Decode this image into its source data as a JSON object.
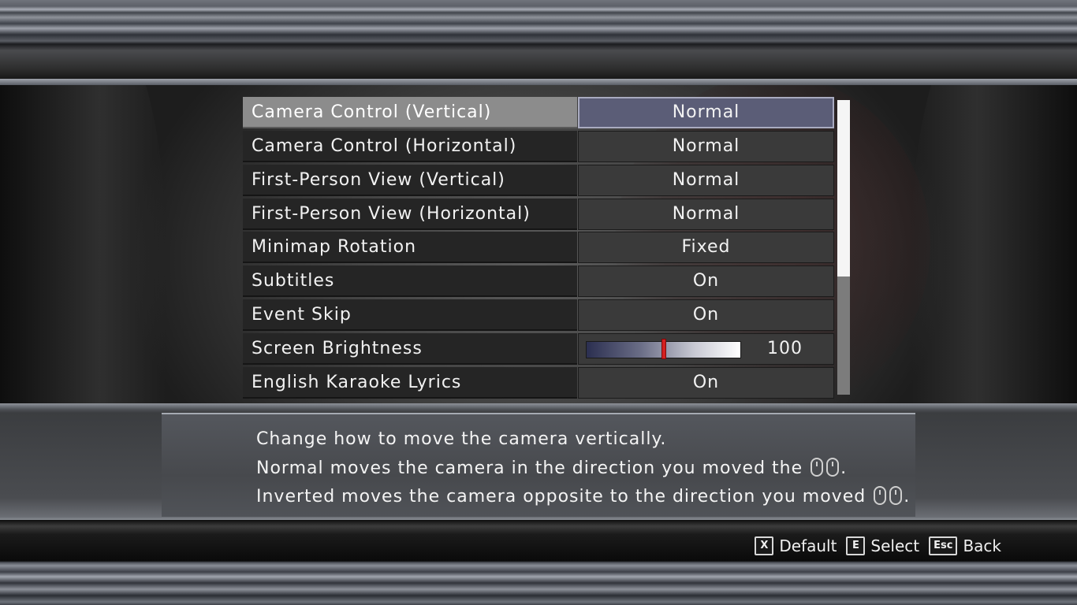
{
  "settings": [
    {
      "label": "Camera Control (Vertical)",
      "value": "Normal",
      "selected": true
    },
    {
      "label": "Camera Control (Horizontal)",
      "value": "Normal"
    },
    {
      "label": "First-Person View (Vertical)",
      "value": "Normal"
    },
    {
      "label": "First-Person View (Horizontal)",
      "value": "Normal"
    },
    {
      "label": "Minimap Rotation",
      "value": "Fixed"
    },
    {
      "label": "Subtitles",
      "value": "On"
    },
    {
      "label": "Event Skip",
      "value": "On"
    },
    {
      "label": "Screen Brightness",
      "value": "100",
      "slider_fraction": 0.5
    },
    {
      "label": "English Karaoke Lyrics",
      "value": "On"
    }
  ],
  "scrollbar": {
    "visible_fraction": 0.6,
    "position_fraction": 0
  },
  "description": {
    "line1": "Change how to move the camera vertically.",
    "line2_a": "Normal moves the camera in the direction you moved the",
    "line2_icon": "mouse-icon",
    "line2_b": ".",
    "line3_a": "Inverted moves the camera opposite to the direction you moved",
    "line3_icon": "mouse-icon",
    "line3_b": "."
  },
  "footer": {
    "default_key": "X",
    "default_label": "Default",
    "select_key": "E",
    "select_label": "Select",
    "back_key": "Esc",
    "back_label": "Back"
  },
  "colors": {
    "selected_value_bg": "#5b5d77",
    "slider_marker": "#d42020"
  }
}
